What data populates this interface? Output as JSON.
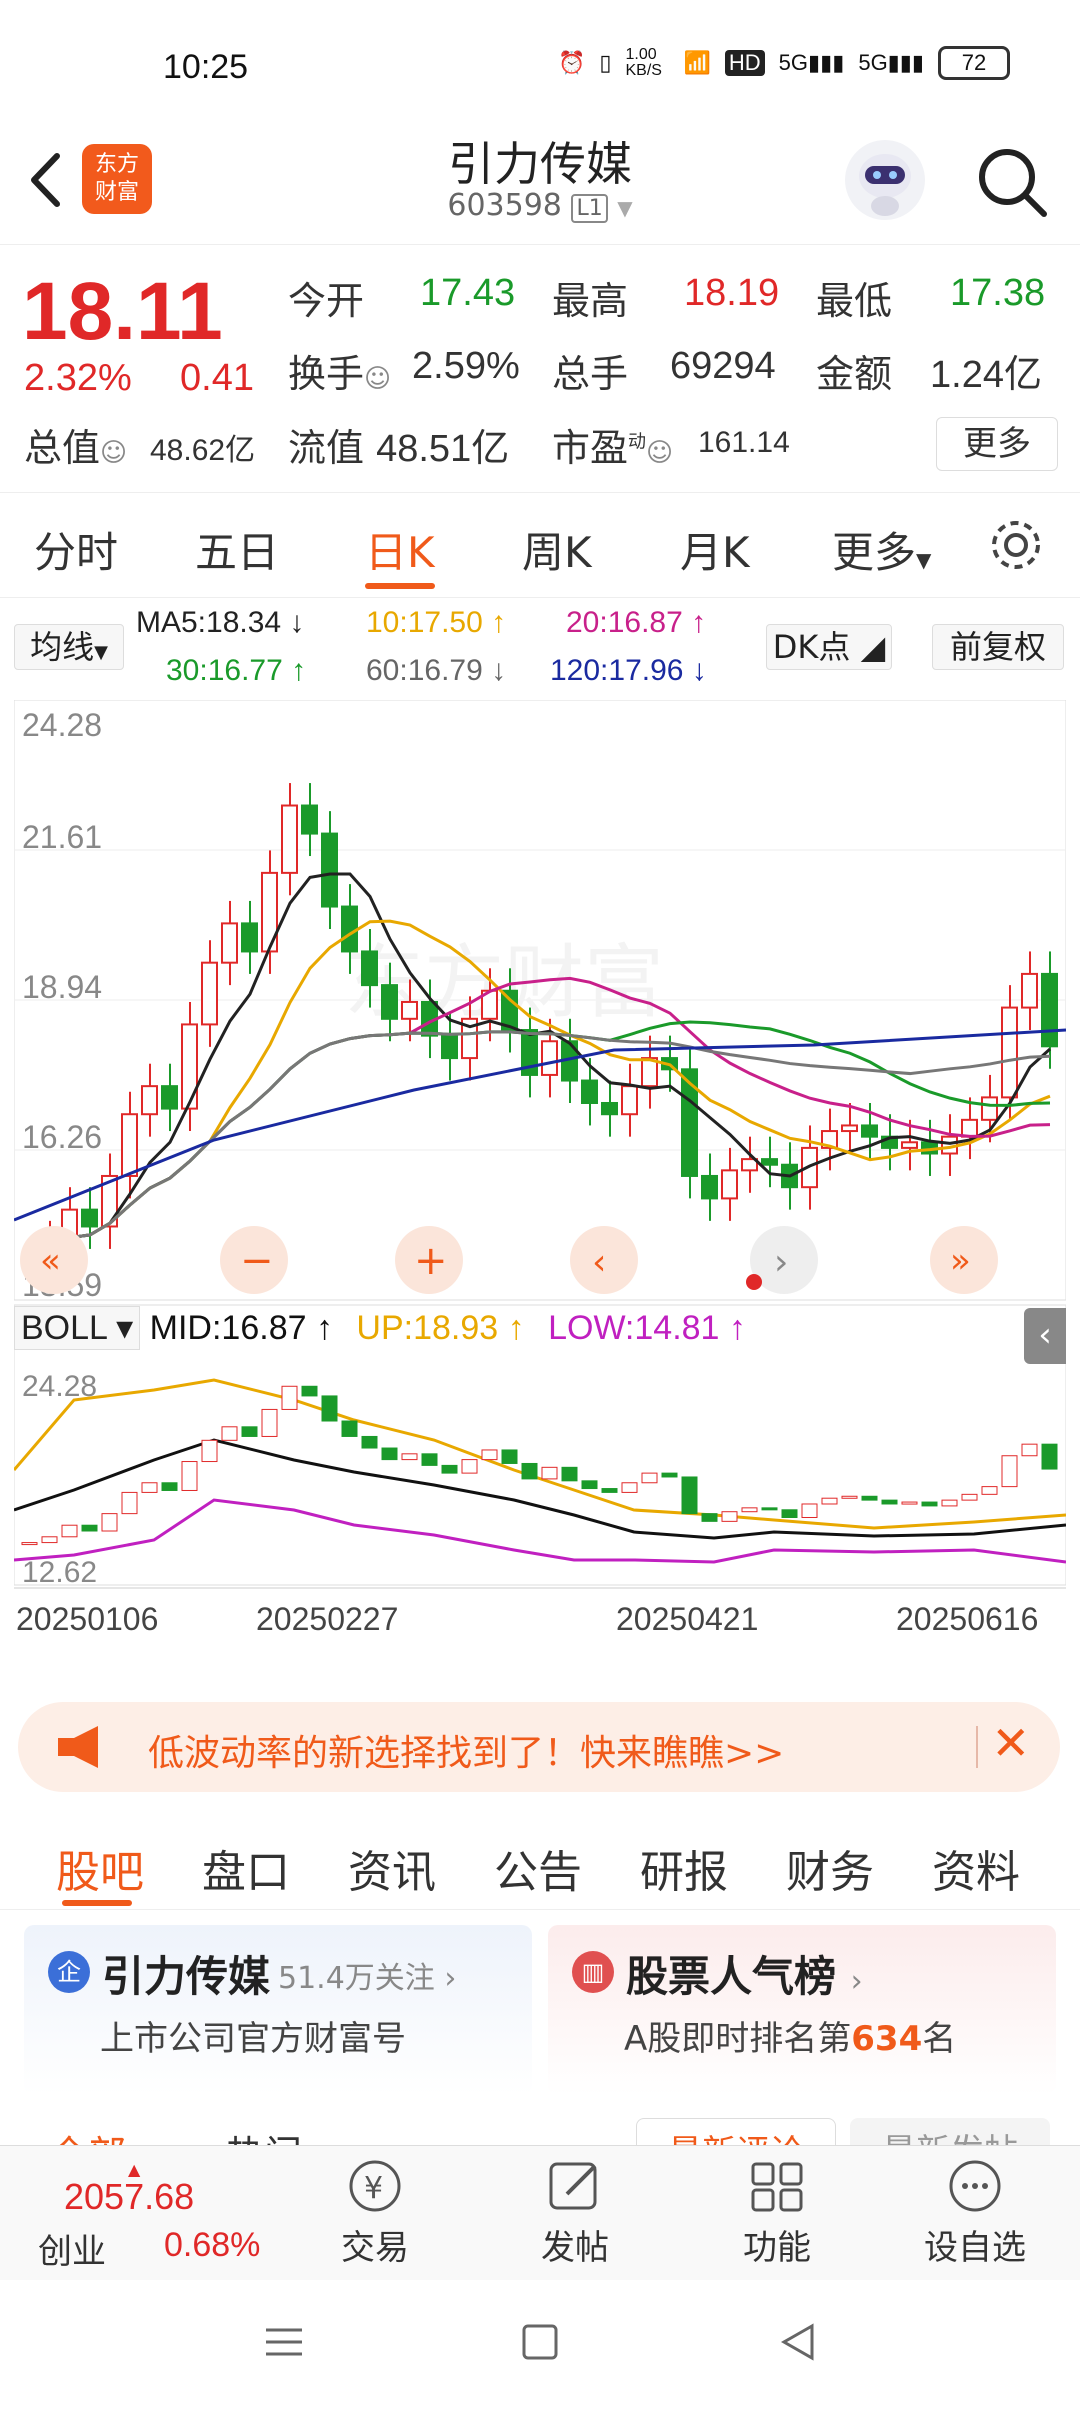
{
  "status": {
    "time": "10:25",
    "net_speed": "1.00\nKB/S",
    "battery": "72"
  },
  "header": {
    "logo_line1": "东方",
    "logo_line2": "财富",
    "title": "引力传媒",
    "code": "603598",
    "level": "L1"
  },
  "quote": {
    "price": "18.11",
    "pct": "2.32%",
    "change": "0.41",
    "open_label": "今开",
    "open": "17.43",
    "high_label": "最高",
    "high": "18.19",
    "low_label": "最低",
    "low": "17.38",
    "turnover_label": "换手",
    "turnover": "2.59%",
    "vol_label": "总手",
    "vol": "69294",
    "amount_label": "金额",
    "amount": "1.24亿",
    "mcap_label": "总值",
    "mcap": "48.62亿",
    "float_label": "流值",
    "float": "48.51亿",
    "pe_label": "市盈",
    "pe_sup": "动",
    "pe": "161.14",
    "more": "更多"
  },
  "period_tabs": [
    "分时",
    "五日",
    "日K",
    "周K",
    "月K",
    "更多"
  ],
  "ma": {
    "type": "均线",
    "ma5": "MA5:18.34",
    "ma10": "10:17.50",
    "ma20": "20:16.87",
    "ma30": "30:16.77",
    "ma60": "60:16.79",
    "ma120": "120:17.96",
    "dk": "DK点",
    "fq": "前复权"
  },
  "chart_data": {
    "type": "candlestick",
    "y_top": "24.28",
    "y_mid1": "21.61",
    "y_mid2": "18.94",
    "y_mid3": "16.26",
    "y_bottom": "13.59",
    "dates": [
      "20250106",
      "20250227",
      "20250421",
      "20250616"
    ],
    "watermark": "东方财富",
    "ylim": [
      13.59,
      24.28
    ],
    "close_approx": [
      14.3,
      14.6,
      15.2,
      14.9,
      15.8,
      16.9,
      17.4,
      17.0,
      18.5,
      19.6,
      20.3,
      19.8,
      21.2,
      22.4,
      21.9,
      20.6,
      19.8,
      19.2,
      18.6,
      18.9,
      18.3,
      17.9,
      18.6,
      19.1,
      18.4,
      17.6,
      18.2,
      17.5,
      17.1,
      16.9,
      17.4,
      17.9,
      17.7,
      15.8,
      15.4,
      15.9,
      16.1,
      16.0,
      15.6,
      16.3,
      16.6,
      16.7,
      16.5,
      16.3,
      16.4,
      16.2,
      16.5,
      16.8,
      17.2,
      18.8,
      19.4,
      18.11
    ]
  },
  "boll": {
    "label": "BOLL",
    "mid": "MID:16.87",
    "up": "UP:18.93",
    "low": "LOW:14.81",
    "y_top": "24.28",
    "y_bottom": "12.62"
  },
  "banner": {
    "text": "低波动率的新选择找到了！快来瞧瞧>>"
  },
  "bottom_tabs": [
    "股吧",
    "盘口",
    "资讯",
    "公告",
    "研报",
    "财务",
    "资料"
  ],
  "cards": {
    "left_title": "引力传媒",
    "left_follow": "51.4万关注",
    "left_sub": "上市公司官方财富号",
    "right_title": "股票人气榜",
    "right_sub_prefix": "A股即时排名第",
    "right_rank": "634",
    "right_sub_suffix": "名"
  },
  "subtabs": {
    "all": "全部",
    "hot": "热门",
    "latest_reply": "最新评论",
    "latest_post": "最新发帖"
  },
  "bottom_bar": {
    "index_value": "2057.68",
    "index_name": "创业",
    "index_pct": "0.68%",
    "trade": "交易",
    "post": "发帖",
    "func": "功能",
    "watch": "设自选"
  }
}
